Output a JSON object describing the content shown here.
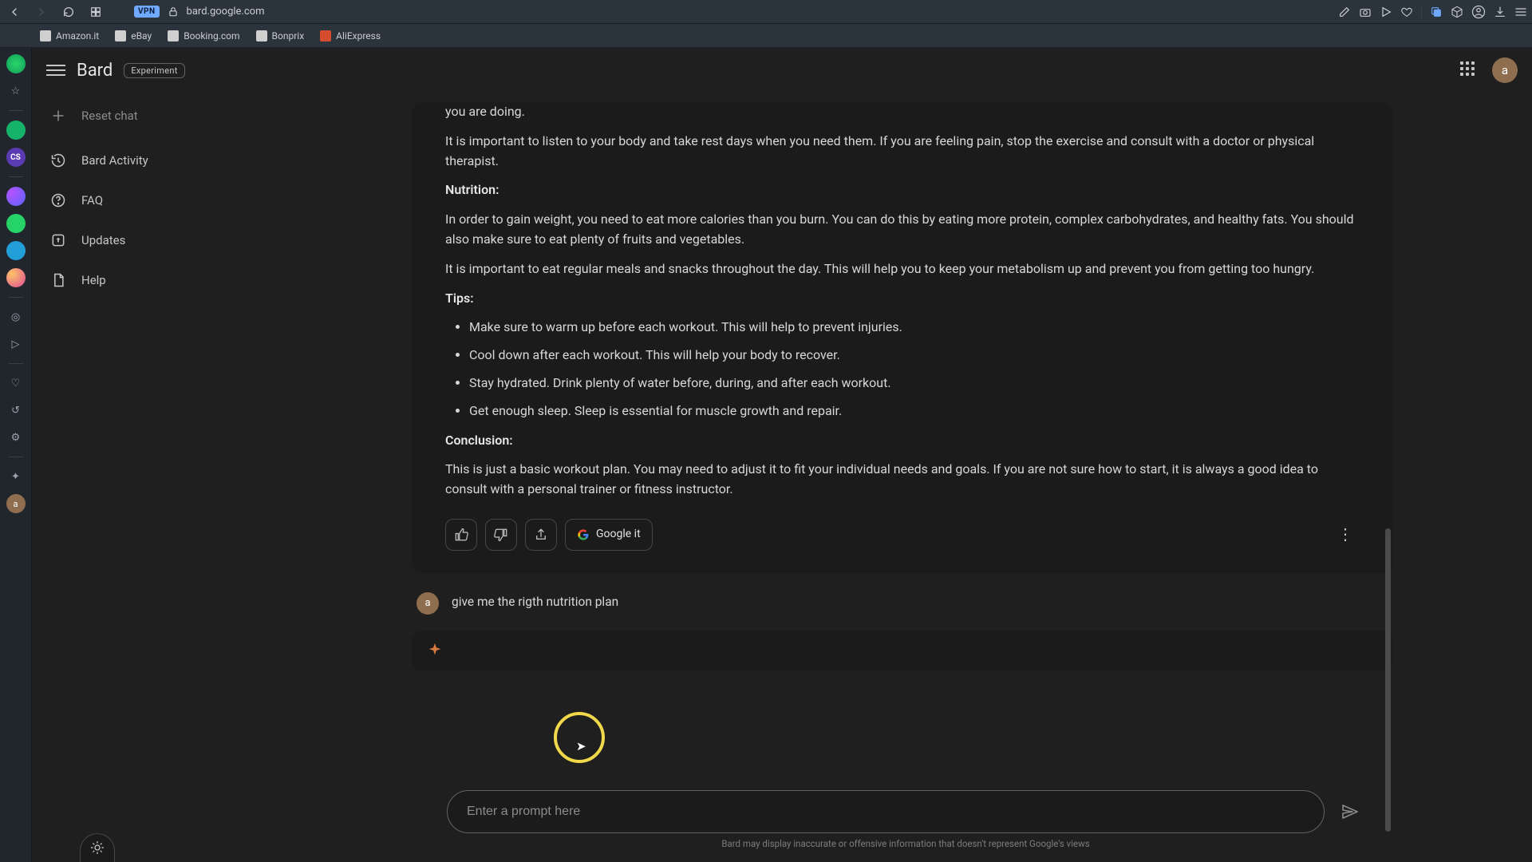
{
  "browser": {
    "url": "bard.google.com",
    "vpn": "VPN",
    "bookmarks": [
      "Amazon.it",
      "eBay",
      "Booking.com",
      "Bonprix",
      "AliExpress"
    ]
  },
  "header": {
    "brand": "Bard",
    "badge": "Experiment",
    "avatar": "a"
  },
  "sidebar": {
    "items": [
      {
        "label": "Reset chat"
      },
      {
        "label": "Bard Activity"
      },
      {
        "label": "FAQ"
      },
      {
        "label": "Updates"
      },
      {
        "label": "Help"
      }
    ]
  },
  "answer": {
    "p_intro_tail": "you are doing.",
    "p_listen": "It is important to listen to your body and take rest days when you need them. If you are feeling pain, stop the exercise and consult with a doctor or physical therapist.",
    "h_nutrition": "Nutrition:",
    "p_nutrition1": "In order to gain weight, you need to eat more calories than you burn. You can do this by eating more protein, complex carbohydrates, and healthy fats. You should also make sure to eat plenty of fruits and vegetables.",
    "p_nutrition2": "It is important to eat regular meals and snacks throughout the day. This will help you to keep your metabolism up and prevent you from getting too hungry.",
    "h_tips": "Tips:",
    "tips": [
      "Make sure to warm up before each workout. This will help to prevent injuries.",
      "Cool down after each workout. This will help your body to recover.",
      "Stay hydrated. Drink plenty of water before, during, and after each workout.",
      "Get enough sleep. Sleep is essential for muscle growth and repair."
    ],
    "h_conclusion": "Conclusion:",
    "p_conclusion": "This is just a basic workout plan. You may need to adjust it to fit your individual needs and goals. If you are not sure how to start, it is always a good idea to consult with a personal trainer or fitness instructor.",
    "google_it": "Google it"
  },
  "user_turn": {
    "avatar": "a",
    "text": "give me the rigth nutrition plan"
  },
  "input": {
    "placeholder": "Enter a prompt here"
  },
  "disclaimer": "Bard may display inaccurate or offensive information that doesn't represent Google's views"
}
